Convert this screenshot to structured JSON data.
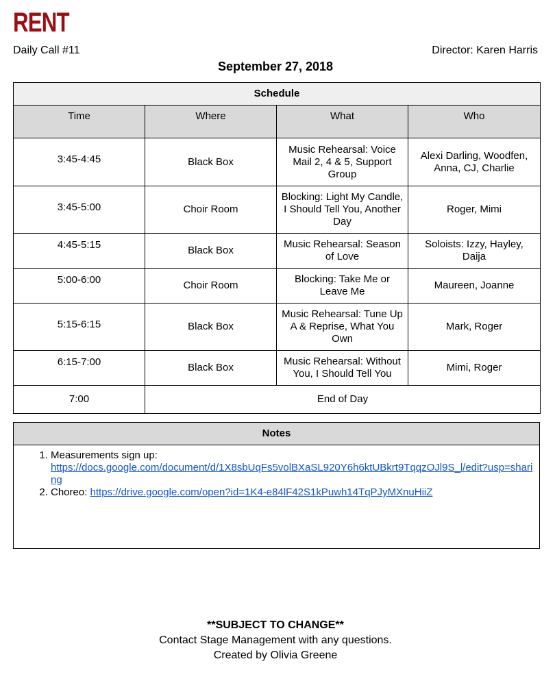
{
  "header": {
    "logo": "RENT",
    "call": "Daily Call #11",
    "director": "Director: Karen Harris",
    "date": "September 27, 2018"
  },
  "schedule": {
    "title": "Schedule",
    "columns": [
      "Time",
      "Where",
      "What",
      "Who"
    ],
    "rows": [
      {
        "time": "3:45-4:45",
        "where": "Black Box",
        "what": "Music Rehearsal: Voice Mail 2, 4 & 5, Support Group",
        "who": "Alexi Darling, Woodfen, Anna, CJ, Charlie"
      },
      {
        "time": "3:45-5:00",
        "where": "Choir Room",
        "what": "Blocking: Light My Candle, I Should Tell You, Another Day",
        "who": "Roger, Mimi"
      },
      {
        "time": "4:45-5:15",
        "where": "Black Box",
        "what": "Music Rehearsal: Season of Love",
        "who": "Soloists: Izzy, Hayley, Daija"
      },
      {
        "time": "5:00-6:00",
        "where": "Choir Room",
        "what": "Blocking: Take Me or Leave Me",
        "who": "Maureen, Joanne"
      },
      {
        "time": "5:15-6:15",
        "where": "Black Box",
        "what": "Music Rehearsal: Tune Up A & Reprise, What You Own",
        "who": "Mark, Roger"
      },
      {
        "time": "6:15-7:00",
        "where": "Black Box",
        "what": "Music Rehearsal: Without You, I Should Tell You",
        "who": "Mimi, Roger"
      }
    ],
    "end_row": {
      "time": "7:00",
      "text": "End of Day"
    }
  },
  "notes": {
    "title": "Notes",
    "items": [
      {
        "label": "Measurements sign up:",
        "link": "https://docs.google.com/document/d/1X8sbUqFs5volBXaSL920Y6h6ktUBkrt9TqqzOJl9S_l/edit?usp=sharing"
      },
      {
        "label": "Choreo:",
        "link": "https://drive.google.com/open?id=1K4-e84lF42S1kPuwh14TqPJyMXnuHiiZ"
      }
    ]
  },
  "footer": {
    "warning": "**SUBJECT TO CHANGE**",
    "contact": "Contact Stage Management with any questions.",
    "created_by": "Created by Olivia Greene"
  }
}
